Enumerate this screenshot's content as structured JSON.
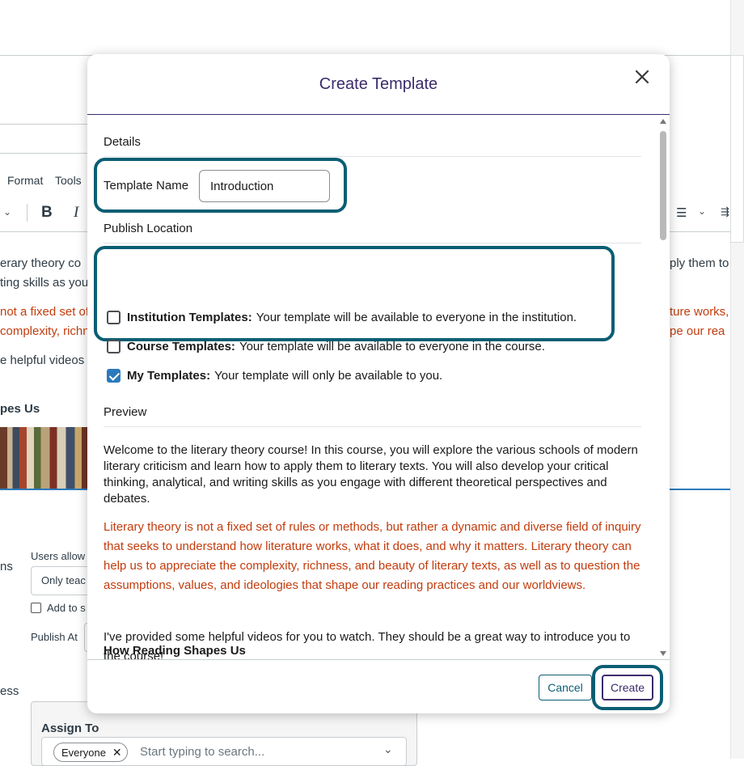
{
  "background": {
    "menu": {
      "format": "Format",
      "tools": "Tools"
    },
    "toolbar": {
      "bold": "B",
      "italic": "I"
    },
    "content_lines": [
      "erary theory co",
      "ting skills as you",
      "not a fixed set of",
      "complexity, richn",
      "e helpful videos",
      "pes Us"
    ],
    "right_lines": [
      "ply them to",
      "ture works,",
      "pe our rea"
    ],
    "users_allowed_label": "Users allow",
    "only_teachers_value": "Only teac",
    "ns_fragment": "ns",
    "add_to_label": "Add to s",
    "publish_at_label": "Publish At",
    "ess_fragment": "ess",
    "assign_to_label": "Assign To",
    "assignee_tag": "Everyone",
    "search_placeholder": "Start typing to search..."
  },
  "modal": {
    "title": "Create Template",
    "details_heading": "Details",
    "template_name_label": "Template Name",
    "template_name_value": "Introduction",
    "publish_location_heading": "Publish Location",
    "options": [
      {
        "title": "Institution Templates:",
        "desc": "Your template will be available to everyone in the institution.",
        "checked": false
      },
      {
        "title": "Course Templates:",
        "desc": "Your template will be available to everyone in the course.",
        "checked": false
      },
      {
        "title": "My Templates:",
        "desc": "Your template will only be available to you.",
        "checked": true
      }
    ],
    "preview_heading": "Preview",
    "preview": {
      "intro": "Welcome to the literary theory course! In this course, you will explore the various schools of modern literary criticism and learn how to apply them to literary texts. You will also develop your critical thinking, analytical, and writing skills as you engage with different theoretical perspectives and debates.",
      "red": "Literary theory is not a fixed set of rules or methods, but rather a dynamic and diverse field of inquiry that seeks to understand how literature works, what it does, and why it matters. Literary theory can help us to appreciate the complexity, richness, and beauty of literary texts, as well as to question the assumptions, values, and ideologies that shape our reading practices and our worldviews.",
      "videos": "I've provided some helpful videos for you to watch. They should be a great way to introduce you to the course!",
      "section_heading": "How Reading Shapes Us"
    },
    "cancel_label": "Cancel",
    "create_label": "Create"
  },
  "colors": {
    "accent_purple": "#3b2b6b",
    "highlight_teal": "#0b5e73",
    "checkbox_blue": "#2b7abc",
    "red_text": "#c23c0d"
  }
}
